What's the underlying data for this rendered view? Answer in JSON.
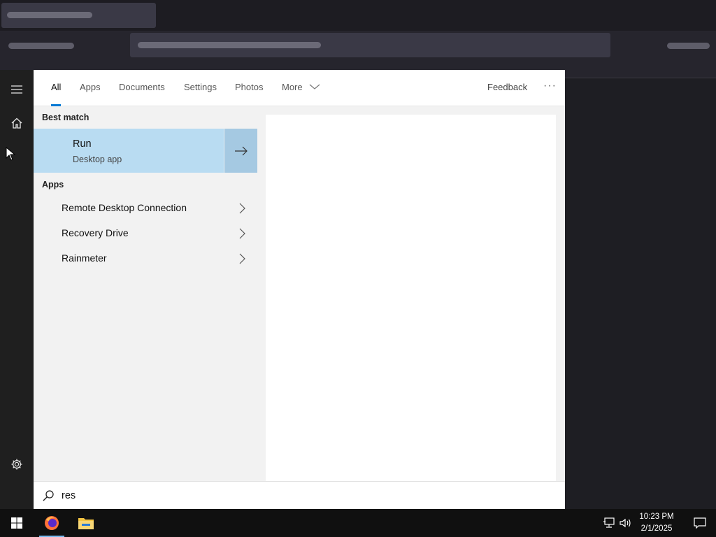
{
  "search_tabs": [
    {
      "label": "All",
      "active": true
    },
    {
      "label": "Apps"
    },
    {
      "label": "Documents"
    },
    {
      "label": "Settings"
    },
    {
      "label": "Photos"
    },
    {
      "label": "More"
    }
  ],
  "header_right": {
    "feedback_label": "Feedback",
    "more_options_label": "···"
  },
  "results": {
    "best_match_label": "Best match",
    "best_match": {
      "title": "Run",
      "subtitle": "Desktop app"
    },
    "apps_label": "Apps",
    "apps": [
      {
        "label": "Remote Desktop Connection"
      },
      {
        "label": "Recovery Drive"
      },
      {
        "label": "Rainmeter"
      }
    ]
  },
  "search": {
    "query": "res"
  },
  "rail": {
    "icons": [
      "hamburger-menu-icon",
      "home-icon",
      "settings-icon"
    ]
  },
  "taskbar": {
    "apps": [
      "windows-start-icon",
      "firefox-icon",
      "file-explorer-icon"
    ],
    "clock": {
      "time": "10:23 PM",
      "date": "2/1/2025"
    },
    "tray_icons": [
      "network-icon",
      "volume-icon",
      "notifications-icon"
    ]
  },
  "colors": {
    "accent": "#0078d4",
    "selection": "#b9dcf2",
    "selection_arrow": "#a5c9e2"
  }
}
